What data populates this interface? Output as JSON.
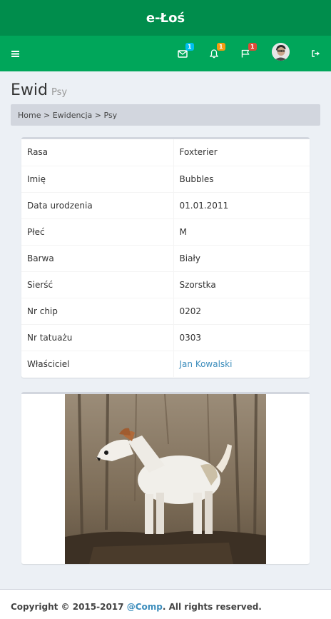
{
  "app": {
    "title": "e-Łoś"
  },
  "navbar": {
    "menu_icon": "bars-icon",
    "messages": {
      "icon": "envelope-icon",
      "count": "1",
      "color": "#00c0ef"
    },
    "notifications": {
      "icon": "bell-icon",
      "count": "1",
      "color": "#f39c12"
    },
    "tasks": {
      "icon": "flag-icon",
      "count": "1",
      "color": "#dd4b39"
    },
    "user": {
      "icon": "avatar"
    },
    "logout_icon": "sign-out-icon"
  },
  "page": {
    "title": "Ewid",
    "subtitle": "Psy"
  },
  "breadcrumb": {
    "home": "Home",
    "sep1": " > ",
    "section": "Ewidencja",
    "sep2": " > ",
    "current": "Psy"
  },
  "details": [
    {
      "label": "Rasa",
      "value": "Foxterier"
    },
    {
      "label": "Imię",
      "value": "Bubbles"
    },
    {
      "label": "Data urodzenia",
      "value": "01.01.2011"
    },
    {
      "label": "Płeć",
      "value": "M"
    },
    {
      "label": "Barwa",
      "value": "Biały"
    },
    {
      "label": "Sierść",
      "value": "Szorstka"
    },
    {
      "label": "Nr chip",
      "value": "0202"
    },
    {
      "label": "Nr tatuażu",
      "value": "0303"
    },
    {
      "label": "Właściciel",
      "value": "Jan Kowalski"
    }
  ],
  "photo": {
    "subject": "wire fox terrier standing on a tree stump"
  },
  "footer": {
    "prefix": "Copyright © 2015-2017 ",
    "link": "@Comp",
    "suffix": ". All rights reserved."
  },
  "colors": {
    "header_dark": "#008d4c",
    "header": "#00a65a",
    "link": "#3c8dbc"
  }
}
